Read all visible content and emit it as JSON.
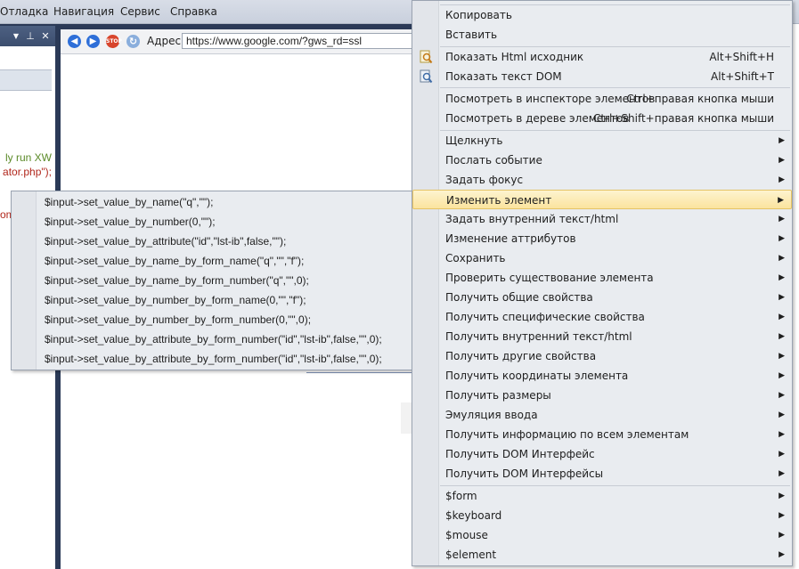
{
  "menubar": {
    "items": [
      "Отладка",
      "Навигация",
      "Сервис",
      "Справка"
    ]
  },
  "left_panel": {
    "code_lines": [
      "ly run XW",
      "ator.php\");",
      "om"
    ]
  },
  "browser": {
    "address_label": "Адрес",
    "address_value": "https://www.google.com/?gws_rd=ssl",
    "icons": [
      "back-arrow-icon",
      "forward-arrow-icon",
      "stop-icon",
      "refresh-icon"
    ]
  },
  "submenu": {
    "items": [
      "$input->set_value_by_name(\"q\",\"\");",
      "$input->set_value_by_number(0,\"\");",
      "$input->set_value_by_attribute(\"id\",\"lst-ib\",false,\"\");",
      "$input->set_value_by_name_by_form_name(\"q\",\"\",\"f\");",
      "$input->set_value_by_name_by_form_number(\"q\",\"\",0);",
      "$input->set_value_by_number_by_form_name(0,\"\",\"f\");",
      "$input->set_value_by_number_by_form_number(0,\"\",0);",
      "$input->set_value_by_attribute_by_form_number(\"id\",\"lst-ib\",false,\"\",0);",
      "$input->set_value_by_attribute_by_form_number(\"id\",\"lst-ib\",false,\"\",0);"
    ]
  },
  "context_menu": {
    "items": [
      {
        "label": "Копировать"
      },
      {
        "label": "Вставить"
      },
      {
        "label": "Показать Html исходник",
        "shortcut": "Alt+Shift+H",
        "icon": "html-source-icon"
      },
      {
        "label": "Показать текст DOM",
        "shortcut": "Alt+Shift+T",
        "icon": "dom-text-icon"
      },
      {
        "label": "Посмотреть в инспекторе элементов",
        "shortcut": "Ctrl+правая кнопка мыши"
      },
      {
        "label": "Посмотреть в дереве элементов",
        "shortcut": "Ctrl+Shift+правая кнопка мыши"
      },
      {
        "label": "Щелкнуть"
      },
      {
        "label": "Послать событие"
      },
      {
        "label": "Задать фокус"
      },
      {
        "label": "Изменить элемент"
      },
      {
        "label": "Задать внутренний текст/html"
      },
      {
        "label": "Изменение аттрибутов"
      },
      {
        "label": "Сохранить"
      },
      {
        "label": "Проверить существование элемента"
      },
      {
        "label": "Получить общие свойства"
      },
      {
        "label": "Получить специфические свойства"
      },
      {
        "label": "Получить внутренний текст/html"
      },
      {
        "label": "Получить другие свойства"
      },
      {
        "label": "Получить координаты элемента"
      },
      {
        "label": "Получить размеры"
      },
      {
        "label": "Эмуляция ввода"
      },
      {
        "label": "Получить информацию по всем элементам"
      },
      {
        "label": "Получить DOM Интерфейс"
      },
      {
        "label": "Получить DOM Интерфейсы"
      },
      {
        "label": "$form"
      },
      {
        "label": "$keyboard"
      },
      {
        "label": "$mouse"
      },
      {
        "label": "$element"
      }
    ],
    "highlighted_item": "Изменить элемент",
    "colors": {
      "highlight": "#fbe39e",
      "menu_bg": "#e9ecf0"
    }
  }
}
